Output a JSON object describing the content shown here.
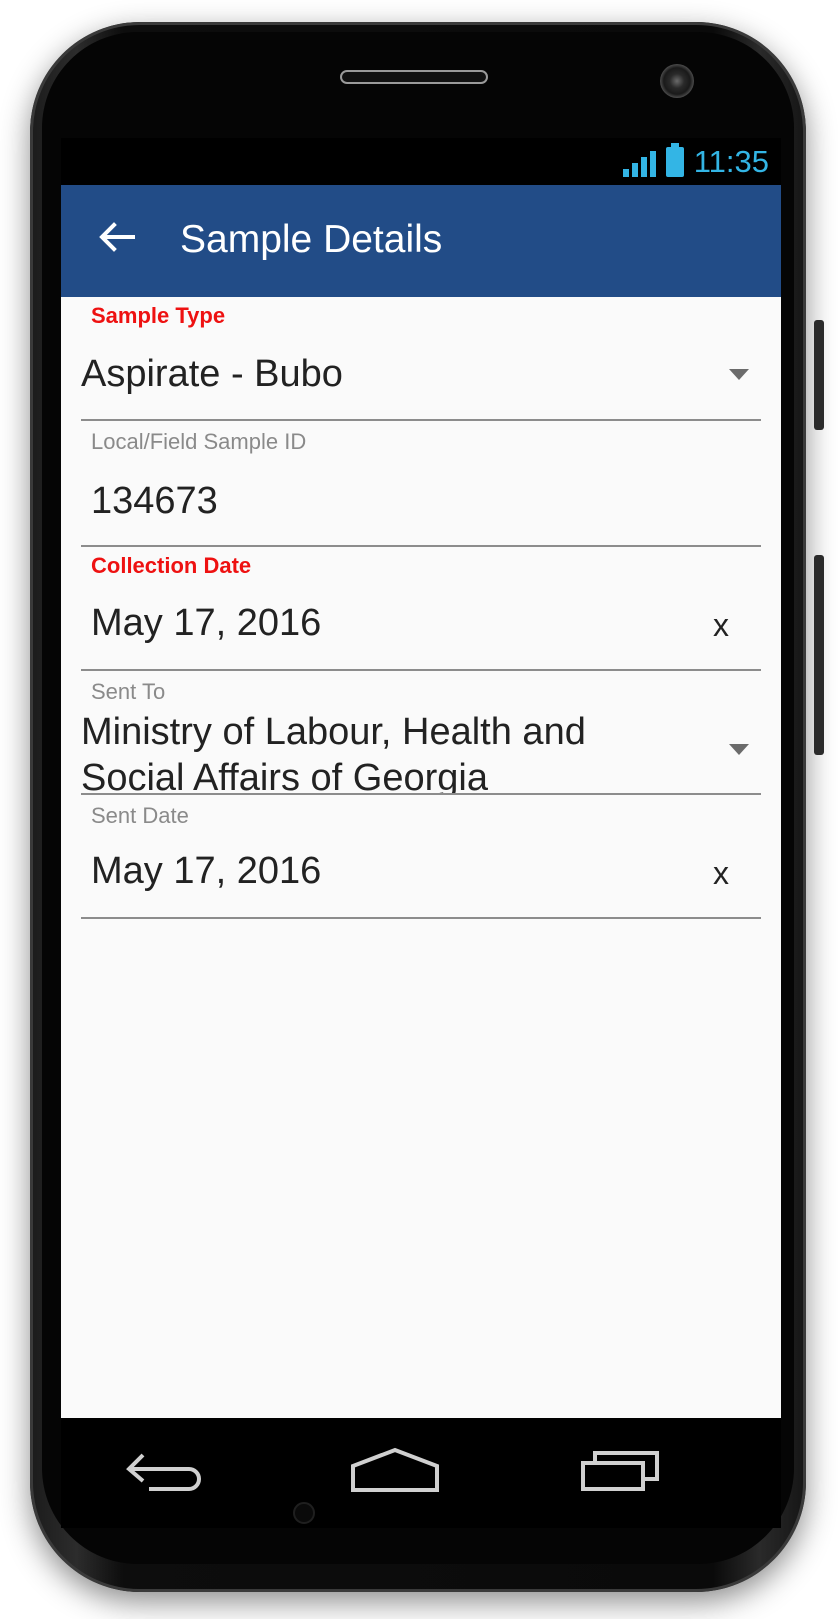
{
  "status_bar": {
    "time": "11:35",
    "signal_icon": "signal-icon",
    "battery_icon": "battery-icon",
    "accent_color": "#33b5e5"
  },
  "app_bar": {
    "title": "Sample Details",
    "back_icon": "arrow-left-icon",
    "color": "#224c87"
  },
  "form": {
    "sample_type": {
      "label": "Sample Type",
      "value": "Aspirate - Bubo"
    },
    "local_field_sample_id": {
      "label": "Local/Field Sample ID",
      "value": "134673"
    },
    "collection_date": {
      "label": "Collection Date",
      "value": "May 17, 2016",
      "clear_label": "x"
    },
    "sent_to": {
      "label": "Sent To",
      "value_line1": "Ministry of Labour, Health and",
      "value_line2": "Social Affairs of Georgia"
    },
    "sent_date": {
      "label": "Sent Date",
      "value": "May 17, 2016",
      "clear_label": "x"
    },
    "required_label_color": "#ee1111"
  },
  "nav_bar": {
    "back_icon": "nav-back-icon",
    "home_icon": "nav-home-icon",
    "recents_icon": "nav-recents-icon"
  }
}
